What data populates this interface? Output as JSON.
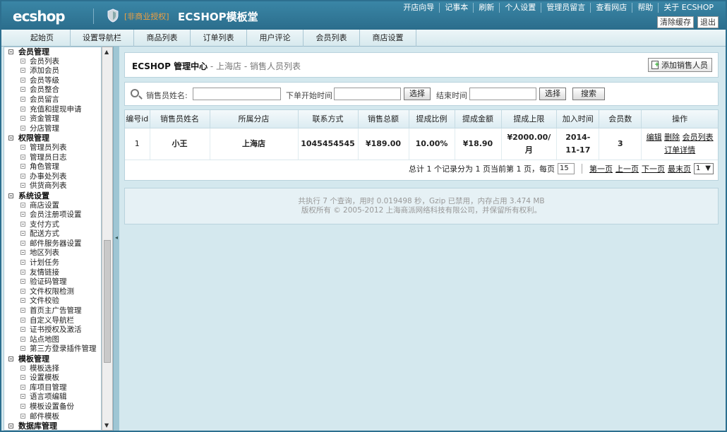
{
  "header": {
    "logo": "ecshop",
    "license_text": "[非商业授权]",
    "brand_title": "ECSHOP模板堂",
    "links": [
      "开店向导",
      "记事本",
      "刷新",
      "个人设置",
      "管理员留言",
      "查看网店",
      "帮助",
      "关于 ECSHOP"
    ],
    "clear_cache": "清除缓存",
    "logout": "退出"
  },
  "nav": {
    "tabs": [
      "起始页",
      "设置导航栏",
      "商品列表",
      "订单列表",
      "用户评论",
      "会员列表",
      "商店设置"
    ]
  },
  "sidebar": {
    "groups": [
      {
        "title": "会员管理",
        "items": [
          "会员列表",
          "添加会员",
          "会员等级",
          "会员整合",
          "会员留言",
          "充值和提现申请",
          "资金管理",
          "分店管理"
        ]
      },
      {
        "title": "权限管理",
        "items": [
          "管理员列表",
          "管理员日志",
          "角色管理",
          "办事处列表",
          "供货商列表"
        ]
      },
      {
        "title": "系统设置",
        "items": [
          "商店设置",
          "会员注册项设置",
          "支付方式",
          "配送方式",
          "邮件服务器设置",
          "地区列表",
          "计划任务",
          "友情链接",
          "验证码管理",
          "文件权限检测",
          "文件校验",
          "首页主广告管理",
          "自定义导航栏",
          "证书授权及激活",
          "站点地图",
          "第三方登录插件管理"
        ]
      },
      {
        "title": "模板管理",
        "items": [
          "模板选择",
          "设置模板",
          "库项目管理",
          "语言项编辑",
          "模板设置备份",
          "邮件模板"
        ]
      },
      {
        "title": "数据库管理",
        "items": []
      }
    ]
  },
  "page": {
    "title_main": "ECSHOP 管理中心",
    "title_sub": " - 上海店 - 销售人员列表",
    "add_button": "添加销售人员"
  },
  "search": {
    "name_label": "销售员姓名:",
    "start_label": "下单开始时间",
    "select_label": "选择",
    "end_label": "结束时间",
    "search_button": "搜索"
  },
  "table": {
    "columns": [
      "编号id",
      "销售员姓名",
      "所属分店",
      "联系方式",
      "销售总额",
      "提成比例",
      "提成金额",
      "提成上限",
      "加入时间",
      "会员数",
      "操作"
    ],
    "rows": [
      {
        "id": "1",
        "name": "小王",
        "store": "上海店",
        "contact": "1045454545",
        "total": "¥189.00",
        "rate": "10.00%",
        "commission": "¥18.90",
        "limit": "¥2000.00/月",
        "joined": "2014-11-17",
        "members": "3",
        "actions": [
          "编辑",
          "删除",
          "会员列表",
          "订单详情"
        ]
      }
    ]
  },
  "pager": {
    "summary": "总计 1 个记录分为 1 页当前第 1 页，每页",
    "page_size": "15",
    "first": "第一页",
    "prev": "上一页",
    "next": "下一页",
    "last": "最末页",
    "current": "1"
  },
  "footer": {
    "line1": "共执行 7 个查询，用时 0.019498 秒，Gzip 已禁用，内存占用 3.474 MB",
    "line2": "版权所有 © 2005-2012 上海商派网络科技有限公司，并保留所有权利。"
  }
}
